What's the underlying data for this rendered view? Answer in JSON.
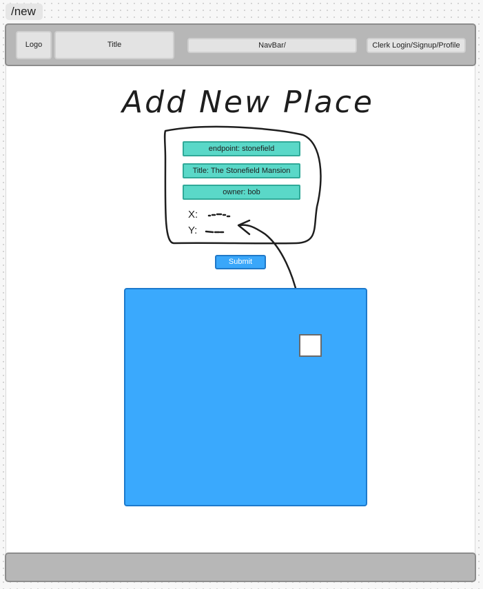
{
  "route": "/new",
  "header": {
    "logo_label": "Logo",
    "title_label": "Title",
    "navbar_label": "NavBar/",
    "auth_label": "Clerk Login/Signup/Profile"
  },
  "page": {
    "heading": "Add New Place"
  },
  "form": {
    "endpoint": "endpoint: stonefield",
    "title": "Title: The Stonefield Mansion",
    "owner": "owner: bob",
    "x_label": "X:",
    "y_label": "Y:",
    "submit_label": "Submit"
  },
  "colors": {
    "field_fill": "#5ad8c8",
    "field_border": "#2fa998",
    "submit_fill": "#3aa7fa",
    "map_fill": "#3aa9fd",
    "bar_fill": "#b7b7b7"
  },
  "icons": {
    "connector": "hand-drawn-arrow-icon"
  }
}
